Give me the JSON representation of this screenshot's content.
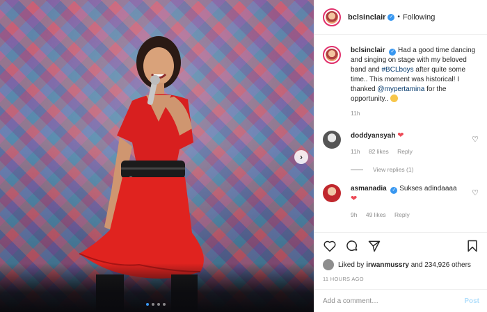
{
  "post": {
    "author": "bclsinclair",
    "follow_state": "Following",
    "caption": {
      "before_tag": "Had a good time dancing and singing on stage with my beloved band and ",
      "hashtag": "#BCLboys",
      "middle": " after quite some time.. This moment was historical! I thanked ",
      "mention": "@mypertamina",
      "after": " for the opportunity.. "
    },
    "caption_age": "11h",
    "carousel": {
      "slides": 4,
      "active_index": 0
    }
  },
  "comments": [
    {
      "user": "doddyansyah",
      "text": "",
      "emoji": "heart",
      "age": "11h",
      "likes": "82 likes",
      "reply_label": "Reply",
      "view_replies": "View replies (1)"
    },
    {
      "user": "asmanadia",
      "text": "Sukses adindaaaa",
      "emoji": "heart",
      "age": "9h",
      "likes": "49 likes",
      "reply_label": "Reply"
    }
  ],
  "actions": {
    "icons": [
      "heart-icon",
      "comment-icon",
      "share-icon",
      "bookmark-icon"
    ],
    "liked_by_prefix": "Liked by ",
    "liked_by_user": "irwanmussry",
    "liked_by_suffix": " and 234,926 others",
    "timestamp": "11 HOURS AGO"
  },
  "add_comment": {
    "placeholder": "Add a comment…",
    "post_label": "Post"
  },
  "colors": {
    "accent": "#3897f0",
    "heart": "#ed4956",
    "link": "#00376b",
    "muted": "#8e8e8e"
  }
}
